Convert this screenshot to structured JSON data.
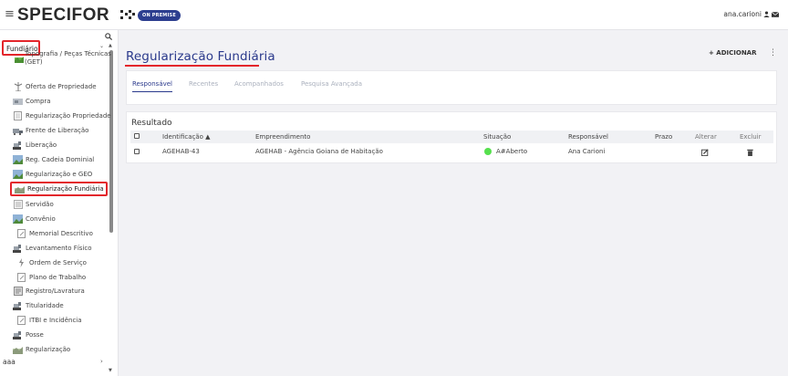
{
  "header": {
    "brand": "SPECIFOR",
    "badge": "ON PREMISE",
    "user": "ana.carioni"
  },
  "sidebar": {
    "section": "Fundiário",
    "topo_item": "Topografia / Peças Técnicas (GET)",
    "items": [
      {
        "label": "Oferta de Propriedade",
        "icon": "handshake-icon"
      },
      {
        "label": "Compra",
        "icon": "cart-icon"
      },
      {
        "label": "Regularização Propriedade",
        "icon": "document-icon"
      },
      {
        "label": "Frente de Liberação",
        "icon": "truck-icon"
      },
      {
        "label": "Liberação",
        "icon": "bulldozer-icon"
      },
      {
        "label": "Reg. Cadeia Dominial",
        "icon": "image-icon"
      },
      {
        "label": "Regularização e GEO",
        "icon": "image-icon"
      },
      {
        "label": "Regularização Fundiária",
        "icon": "landscape-icon"
      },
      {
        "label": "Servidão",
        "icon": "list-icon"
      },
      {
        "label": "Convênio",
        "icon": "image-icon"
      },
      {
        "label": "Memorial Descritivo",
        "icon": "edit-icon"
      },
      {
        "label": "Levantamento Físico",
        "icon": "bulldozer-icon"
      },
      {
        "label": "Ordem de Serviço",
        "icon": "bolt-icon"
      },
      {
        "label": "Plano de Trabalho",
        "icon": "edit-icon"
      },
      {
        "label": "Registro/Lavratura",
        "icon": "register-icon"
      },
      {
        "label": "Titularidade",
        "icon": "bulldozer-icon"
      },
      {
        "label": "ITBI e Incidência",
        "icon": "edit-icon"
      },
      {
        "label": "Posse",
        "icon": "bulldozer-icon"
      },
      {
        "label": "Regularização",
        "icon": "landscape-icon"
      }
    ],
    "bottom": "aaa"
  },
  "main": {
    "title": "Regularização Fundiária",
    "add_label": "+ ADICIONAR",
    "tabs": [
      "Responsável",
      "Recentes",
      "Acompanhados",
      "Pesquisa Avançada"
    ],
    "result_title": "Resultado",
    "columns": [
      "Identificação ▲",
      "Empreendimento",
      "Situação",
      "Responsável",
      "Prazo",
      "Alterar",
      "Excluir"
    ],
    "rows": [
      {
        "id": "AGEHAB-43",
        "empreendimento": "AGEHAB - Agência Goiana de Habitação",
        "situacao": "A#Aberto",
        "responsavel": "Ana Carioni",
        "prazo": ""
      }
    ]
  },
  "colors": {
    "accent": "#2b3a8c",
    "highlight": "#e3262b",
    "status_open": "#56e04e"
  }
}
